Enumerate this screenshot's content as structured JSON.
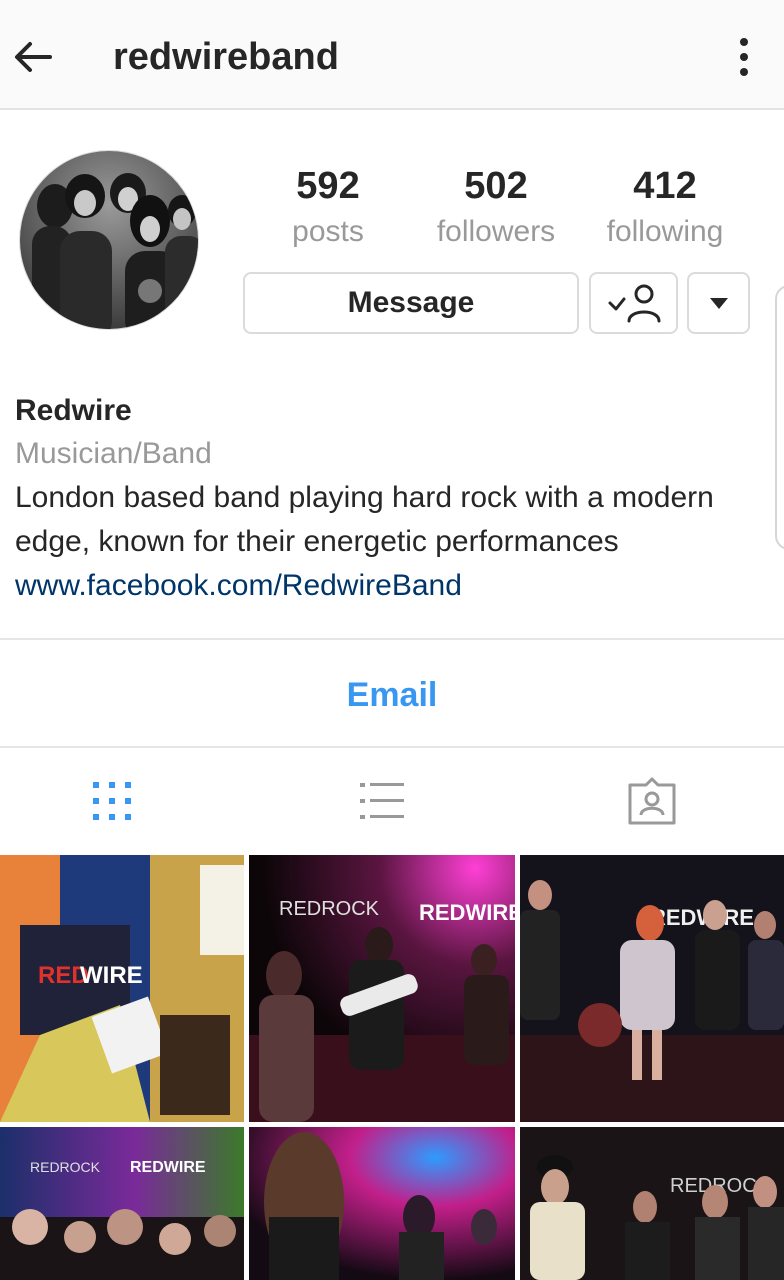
{
  "header": {
    "username": "redwireband",
    "back_icon": "arrow-left-icon",
    "menu_icon": "more-vertical-icon"
  },
  "profile": {
    "stats": [
      {
        "value": "592",
        "label": "posts"
      },
      {
        "value": "502",
        "label": "followers"
      },
      {
        "value": "412",
        "label": "following"
      }
    ],
    "message_label": "Message",
    "following_icon": "person-check-icon",
    "dropdown_icon": "caret-down-icon"
  },
  "bio": {
    "name": "Redwire",
    "category": "Musician/Band",
    "line1": "London based band playing hard rock with a modern",
    "line2": "edge, known for their energetic performances",
    "link": "www.facebook.com/RedwireBand"
  },
  "contact": {
    "email_label": "Email"
  },
  "tabs": [
    {
      "icon": "grid-icon",
      "active": true
    },
    {
      "icon": "list-icon",
      "active": false
    },
    {
      "icon": "tagged-icon",
      "active": false
    }
  ],
  "colors": {
    "accent": "#3897f0",
    "link": "#003569",
    "muted": "#999999",
    "text": "#262626"
  }
}
